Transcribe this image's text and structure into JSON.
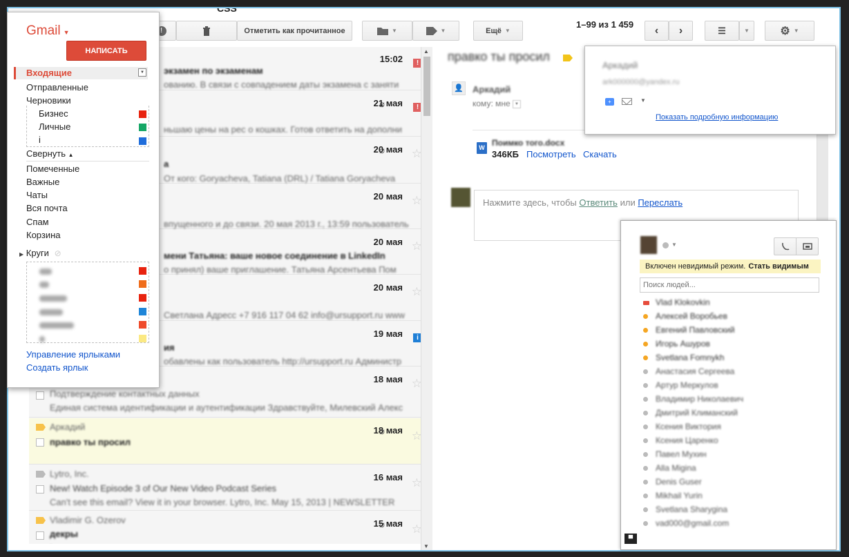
{
  "window": {
    "title": "CSS"
  },
  "nav": {
    "brand": "Gmail",
    "compose": "НАПИСАТЬ",
    "inbox": "Входящие",
    "items": [
      "Отправленные",
      "Черновики"
    ],
    "labels": [
      {
        "name": "Бизнес",
        "color": "#e8230f"
      },
      {
        "name": "Личные",
        "color": "#16a766"
      },
      {
        "name": "i",
        "color": "#1f6ddb"
      }
    ],
    "collapse": "Свернуть",
    "more_items": [
      "Помеченные",
      "Важные",
      "Чаты",
      "Вся почта",
      "Спам",
      "Корзина"
    ],
    "circles": "Круги",
    "circle_colors": [
      "#e8230f",
      "#ef6c1b",
      "#e8230f",
      "#1f86d8",
      "#ef4a2a",
      "#fbe983"
    ],
    "manage": "Управление ярлыками",
    "create": "Создать ярлык"
  },
  "toolbar": {
    "mark_read": "Отметить как прочитанное",
    "more": "Ещё",
    "pager": "1–99 из 1 459"
  },
  "messages": {
    "dates": [
      "15:02",
      "21 мая",
      "20 мая",
      "20 мая",
      "20 мая",
      "20 мая",
      "20 мая",
      "19 мая",
      "18 мая",
      "18 мая",
      "16 мая",
      "15 мая"
    ]
  },
  "reading": {
    "recipient": "кому: мне",
    "attachment_size": "346КБ",
    "view": "Посмотреть",
    "download": "Скачать",
    "reply_prefix": "Нажмите здесь, чтобы",
    "reply": "Ответить",
    "or": "или",
    "forward": "Переслать"
  },
  "contact_card": {
    "more_info": "Показать подробную информацию"
  },
  "chat": {
    "invisible": "Включен невидимый режим.",
    "go_visible": "Стать видимым",
    "search_placeholder": "Поиск людей...",
    "contacts": [
      "Vlad Klokovkin",
      "Алексей Воробьев",
      "Евгений Павловский",
      "Игорь Ашуров",
      "Svetlana Fomnykh",
      "Анастасия Сергеева",
      "Артур Меркулов",
      "Владимир Николаевич",
      "Дмитрий Климанский",
      "Ксения Виктория",
      "Ксения Царенко",
      "Павел Мухин",
      "Alla Migina",
      "Denis Guser",
      "Mikhail Yurin",
      "Svetlana Sharygina",
      "vad000@gmail.com"
    ]
  }
}
